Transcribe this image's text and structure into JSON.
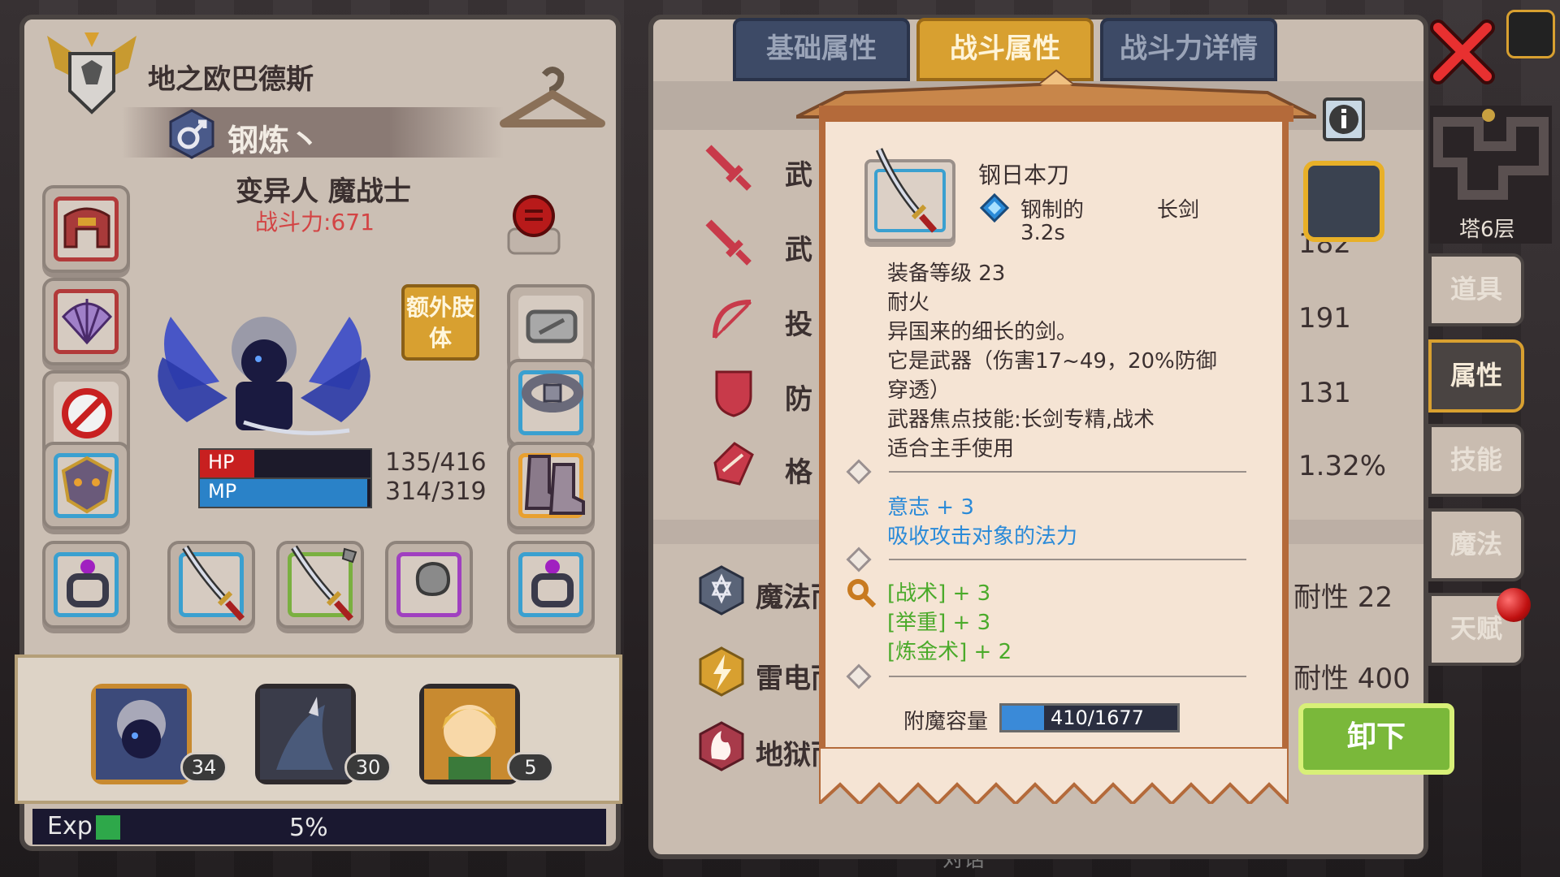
{
  "character": {
    "name": "地之欧巴德斯",
    "title": "钢炼丶",
    "race_class": "变异人 魔战士",
    "power_label": "战斗力:671",
    "hp_label": "HP",
    "mp_label": "MP",
    "hp_value": "135/416",
    "mp_value": "314/319",
    "hp_fraction": 0.32,
    "mp_fraction": 0.98,
    "extra_limb_label": "额外肢体"
  },
  "party": [
    {
      "level": "34",
      "selected": true
    },
    {
      "level": "30",
      "selected": false
    },
    {
      "level": "5",
      "selected": false
    }
  ],
  "exp": {
    "label": "Exp",
    "percent": "5%"
  },
  "tabs": [
    {
      "label": "基础属性",
      "active": false
    },
    {
      "label": "战斗属性",
      "active": true
    },
    {
      "label": "战斗力详情",
      "active": false
    }
  ],
  "stats": [
    {
      "label_partial": "武",
      "value": ""
    },
    {
      "label_partial": "武",
      "value": "182"
    },
    {
      "label_partial": "投",
      "value": "191"
    },
    {
      "label_partial": "防",
      "value": "131"
    },
    {
      "label_partial": "格",
      "value": "1.32%"
    }
  ],
  "resist": [
    {
      "label_partial": "魔法而",
      "value_partial": "耐性 22"
    },
    {
      "label_partial": "雷电而",
      "value_partial": "耐性 400"
    },
    {
      "label_partial": "地狱而",
      "value_partial": ""
    }
  ],
  "side_tabs": [
    {
      "label": "道具",
      "active": false
    },
    {
      "label": "属性",
      "active": true
    },
    {
      "label": "技能",
      "active": false
    },
    {
      "label": "魔法",
      "active": false
    },
    {
      "label": "天赋",
      "active": false
    }
  ],
  "map": {
    "floor": "塔6层"
  },
  "item": {
    "name": "钢日本刀",
    "material": "钢制的",
    "type": "长剑",
    "speed": "3.2s",
    "level": "装备等级 23",
    "trait": "耐火",
    "desc1": "异国来的细长的剑。",
    "desc2": "它是武器（伤害17~49，20%防御",
    "desc3": "穿透）",
    "desc4": "武器焦点技能:长剑专精,战术",
    "desc5": "适合主手使用",
    "bonus1": "意志 + 3",
    "bonus2": "吸收攻击对象的法力",
    "skill1": "[战术] + 3",
    "skill2": "[举重] + 3",
    "skill3": "[炼金术] + 2",
    "enchant_label": "附魔容量",
    "enchant_value": "410/1677",
    "enchant_fraction": 0.24
  },
  "buttons": {
    "unequip": "卸下"
  },
  "bottom_partial": "对话",
  "colors": {
    "accent_gold": "#d8a030",
    "hp_red": "#c82020",
    "mp_blue": "#2a82c8",
    "power_red": "#d34444",
    "bonus_blue": "#2a8ad8",
    "skill_green": "#4aaa2a",
    "unequip_green": "#7ab83a"
  },
  "icons": [
    "emblem-icon",
    "hanger-icon",
    "male-icon",
    "helmet-icon",
    "red-mask-icon",
    "shell-icon",
    "blocked-icon",
    "mask-icon",
    "ring-icon",
    "katana-icon",
    "stone-icon",
    "belt-icon",
    "boots-icon",
    "sword-icon",
    "bow-icon",
    "shield-icon",
    "parry-icon",
    "magic-resist-icon",
    "lightning-icon",
    "hell-icon",
    "close-icon",
    "info-icon",
    "scroll-icon"
  ]
}
